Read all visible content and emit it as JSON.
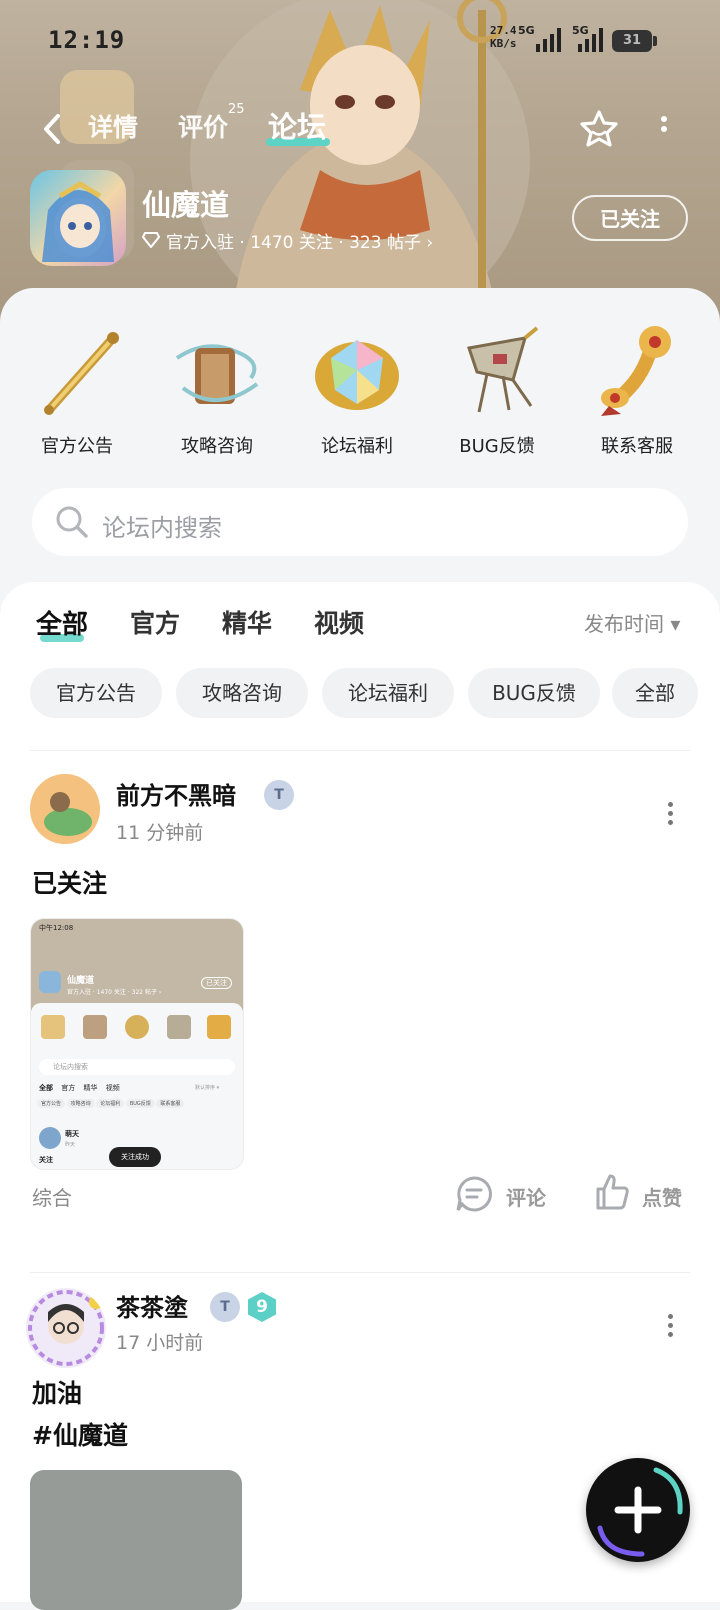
{
  "status_bar": {
    "time": "12:19",
    "net_speed_value": "27.4",
    "net_speed_unit": "KB/s",
    "network_1": "5G",
    "network_2": "5G",
    "battery": "31"
  },
  "nav": {
    "tabs": [
      {
        "label": "详情"
      },
      {
        "label": "评价",
        "count": "25"
      },
      {
        "label": "论坛"
      }
    ]
  },
  "game": {
    "name": "仙魔道",
    "meta": "官方入驻 · 1470 关注 · 323 帖子 ›",
    "follow_label": "已关注"
  },
  "categories": [
    {
      "label": "官方公告",
      "icon": "golden-staff-icon"
    },
    {
      "label": "攻略咨询",
      "icon": "scroll-icon"
    },
    {
      "label": "论坛福利",
      "icon": "rainbow-gem-icon"
    },
    {
      "label": "BUG反馈",
      "icon": "broken-kite-icon"
    },
    {
      "label": "联系客服",
      "icon": "ruyi-scepter-icon"
    }
  ],
  "search": {
    "placeholder": "论坛内搜索"
  },
  "feed_tabs": [
    {
      "label": "全部",
      "active": true
    },
    {
      "label": "官方"
    },
    {
      "label": "精华"
    },
    {
      "label": "视频"
    }
  ],
  "sort_label": "发布时间 ▾",
  "chips": [
    "官方公告",
    "攻略咨询",
    "论坛福利",
    "BUG反馈",
    "全部"
  ],
  "posts": [
    {
      "user": "前方不黑暗",
      "badge": "T",
      "time": "11 分钟前",
      "title": "已关注",
      "thumbnail_text": {
        "status": "中午12:08",
        "game": "仙魔道",
        "meta": "官方入驻 · 1470 关注 · 322 帖子 ›",
        "follow": "已关注",
        "search": "论坛内搜索",
        "toast": "关注成功",
        "user": "萌天",
        "time": "昨天",
        "post": "关注",
        "sort": "默认排序 ▾",
        "chip5": "联系客服"
      },
      "tag": "综合",
      "comment_label": "评论",
      "like_label": "点赞"
    },
    {
      "user": "茶茶塗",
      "badge": "T",
      "level": "9",
      "time": "17 小时前",
      "title": "加油",
      "topic": "#仙魔道"
    }
  ],
  "colors": {
    "accent": "#5dd3c5",
    "hero": "#b3a58f"
  }
}
